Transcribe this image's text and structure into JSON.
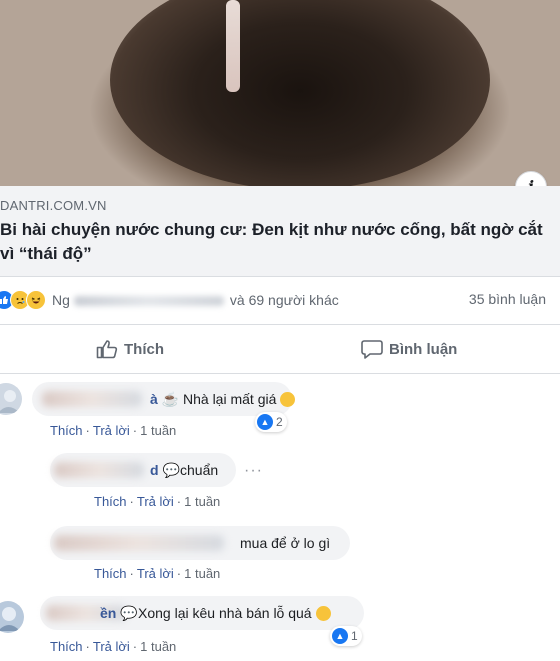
{
  "post": {
    "link_domain": "DANTRI.COM.VN",
    "link_title": "Bi hài chuyện nước chung cư: Đen kịt như nước cống, bất ngờ cắt vì “thái độ”",
    "info_icon": "info-icon",
    "reactions_text": "và 69 người khác",
    "reactions_name_prefix": "Ng",
    "comments_count": "35 bình luận"
  },
  "actions": {
    "like_label": "Thích",
    "comment_label": "Bình luận"
  },
  "comments": [
    {
      "text": "Nhà lại mất giá",
      "name_tail": "à ☕",
      "like_label": "Thích",
      "reply_label": "Trả lời",
      "time": "1 tuần",
      "reaction_count": "2"
    },
    {
      "text": "chuẩn",
      "name_tail": "d 💬",
      "like_label": "Thích",
      "reply_label": "Trả lời",
      "time": "1 tuần"
    },
    {
      "text": "mua để ở lo gì",
      "like_label": "Thích",
      "reply_label": "Trả lời",
      "time": "1 tuần"
    },
    {
      "text": "Xong lại kêu nhà bán lỗ quá",
      "name_tail": "ền 💬",
      "like_label": "Thích",
      "reply_label": "Trả lời",
      "time": "1 tuần",
      "reaction_count": "1"
    }
  ],
  "colors": {
    "facebook_blue": "#1877f2",
    "link_color": "#385898",
    "meta_gray": "#606770"
  }
}
